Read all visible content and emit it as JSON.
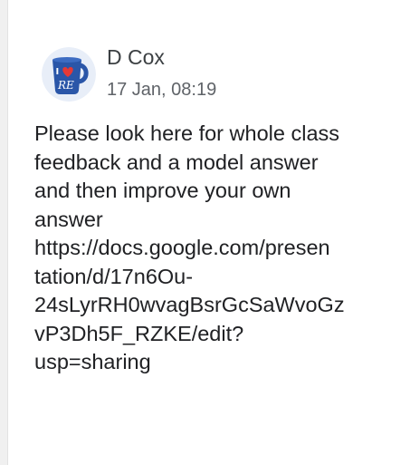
{
  "comment": {
    "author": "D Cox",
    "timestamp": "17 Jan, 08:19",
    "avatar_icon": "i-love-re-mug-icon",
    "mug_text": "RE",
    "message": "Please look here for whole class\nfeedback and a model answer\nand then improve your own\nanswer\nhttps://docs.google.com/presen\ntation/d/17n6Ou-\n24sLyrRH0wvagBsrGcSaWvoGz\nvP3Dh5F_RZKE/edit?\nusp=sharing"
  },
  "colors": {
    "mug_blue": "#2a56a8",
    "heart_red": "#e53935",
    "author_text": "#3c4043",
    "timestamp_text": "#5f6368",
    "body_text": "#202124"
  }
}
